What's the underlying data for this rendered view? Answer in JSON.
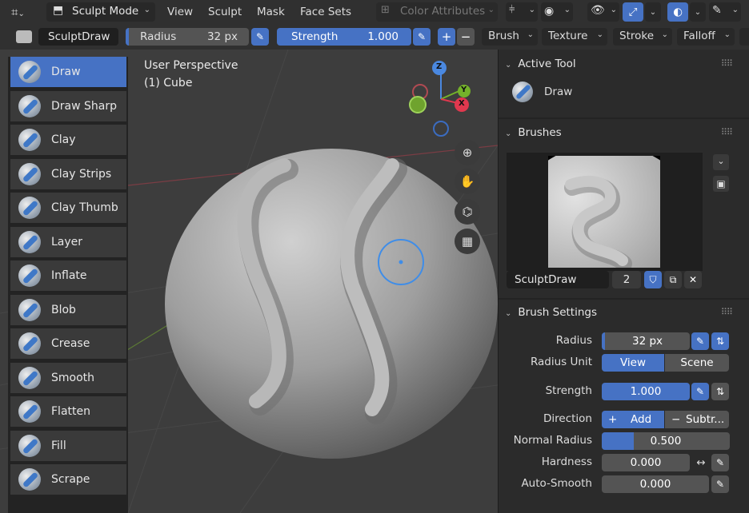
{
  "header": {
    "mode": "Sculpt Mode",
    "menus": [
      "View",
      "Sculpt",
      "Mask",
      "Face Sets"
    ],
    "color_attributes": "Color Attributes"
  },
  "toolbar": {
    "brush_name": "SculptDraw",
    "radius_label": "Radius",
    "radius_value": "32 px",
    "strength_label": "Strength",
    "strength_value": "1.000",
    "plus": "+",
    "minus": "−",
    "menus": [
      "Brush",
      "Texture",
      "Stroke",
      "Falloff"
    ]
  },
  "viewport": {
    "perspective": "User Perspective",
    "object": "(1) Cube",
    "axes": {
      "z": "Z",
      "y": "Y",
      "x": "X"
    }
  },
  "tools": [
    "Draw",
    "Draw Sharp",
    "Clay",
    "Clay Strips",
    "Clay Thumb",
    "Layer",
    "Inflate",
    "Blob",
    "Crease",
    "Smooth",
    "Flatten",
    "Fill",
    "Scrape"
  ],
  "active_tool_index": 0,
  "properties": {
    "active_tool": {
      "title": "Active Tool",
      "name": "Draw"
    },
    "brushes": {
      "title": "Brushes",
      "brush_name": "SculptDraw",
      "users": "2"
    },
    "brush_settings": {
      "title": "Brush Settings",
      "radius_label": "Radius",
      "radius_value": "32 px",
      "radius_unit_label": "Radius Unit",
      "unit_view": "View",
      "unit_scene": "Scene",
      "strength_label": "Strength",
      "strength_value": "1.000",
      "direction_label": "Direction",
      "dir_add": "Add",
      "dir_subtract": "Subtr...",
      "normal_radius_label": "Normal Radius",
      "normal_radius_value": "0.500",
      "normal_radius_fill": 0.25,
      "hardness_label": "Hardness",
      "hardness_value": "0.000",
      "auto_smooth_label": "Auto-Smooth",
      "auto_smooth_value": "0.000"
    }
  },
  "colors": {
    "accent": "#4672c4",
    "panel": "#2b2b2b",
    "viewport": "#3d3d3d"
  }
}
